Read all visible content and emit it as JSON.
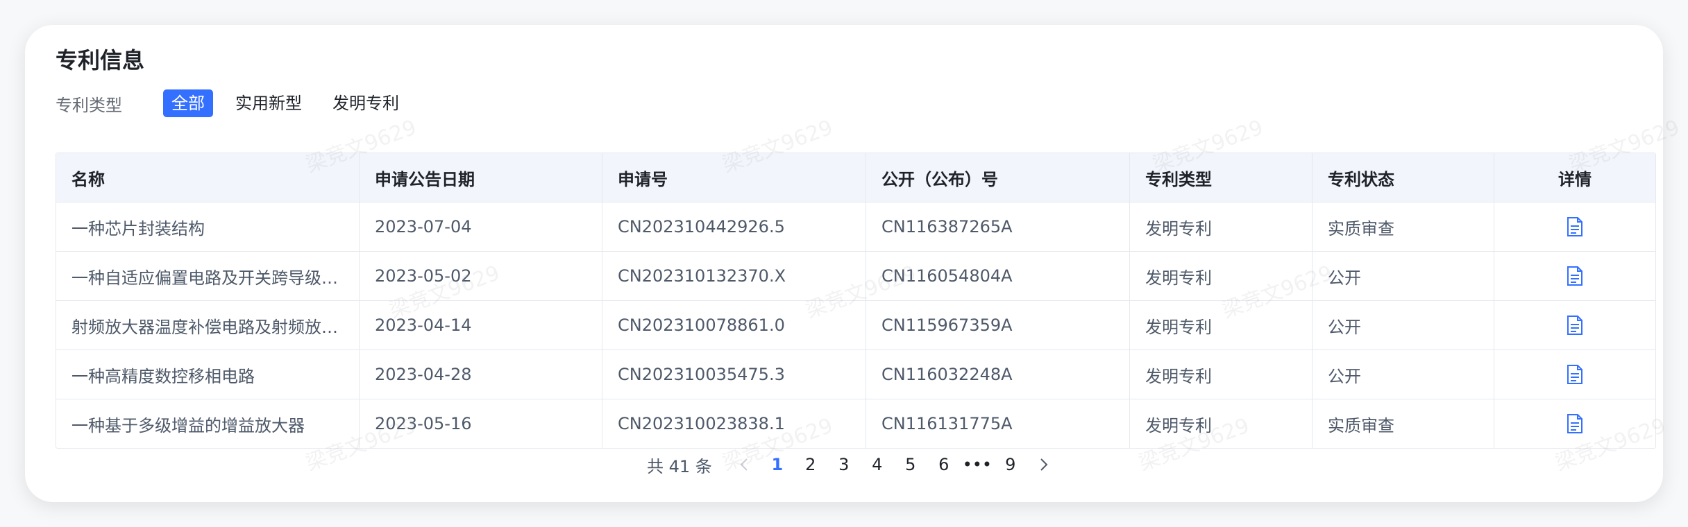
{
  "section": {
    "title": "专利信息",
    "filter_label": "专利类型",
    "filters": [
      "全部",
      "实用新型",
      "发明专利"
    ],
    "active_filter": "全部"
  },
  "table": {
    "columns": [
      "名称",
      "申请公告日期",
      "申请号",
      "公开（公布）号",
      "专利类型",
      "专利状态",
      "详情"
    ],
    "rows": [
      {
        "name": "一种芯片封装结构",
        "date": "2023-07-04",
        "app_no": "CN202310442926.5",
        "pub_no": "CN116387265A",
        "type": "发明专利",
        "status": "实质审查"
      },
      {
        "name": "一种自适应偏置电路及开关跨导级…",
        "date": "2023-05-02",
        "app_no": "CN202310132370.X",
        "pub_no": "CN116054804A",
        "type": "发明专利",
        "status": "公开"
      },
      {
        "name": "射频放大器温度补偿电路及射频放…",
        "date": "2023-04-14",
        "app_no": "CN202310078861.0",
        "pub_no": "CN115967359A",
        "type": "发明专利",
        "status": "公开"
      },
      {
        "name": "一种高精度数控移相电路",
        "date": "2023-04-28",
        "app_no": "CN202310035475.3",
        "pub_no": "CN116032248A",
        "type": "发明专利",
        "status": "公开"
      },
      {
        "name": "一种基于多级增益的增益放大器",
        "date": "2023-05-16",
        "app_no": "CN202310023838.1",
        "pub_no": "CN116131775A",
        "type": "发明专利",
        "status": "实质审查"
      }
    ],
    "detail_icon": "document-icon"
  },
  "pagination": {
    "total_text": "共 41 条",
    "pages": [
      "1",
      "2",
      "3",
      "4",
      "5",
      "6",
      "•••",
      "9"
    ],
    "current": "1"
  },
  "watermark": "梁竞文9629",
  "colors": {
    "accent": "#3370ff",
    "header_bg": "#f2f6fc",
    "border": "#e5e8ee"
  }
}
